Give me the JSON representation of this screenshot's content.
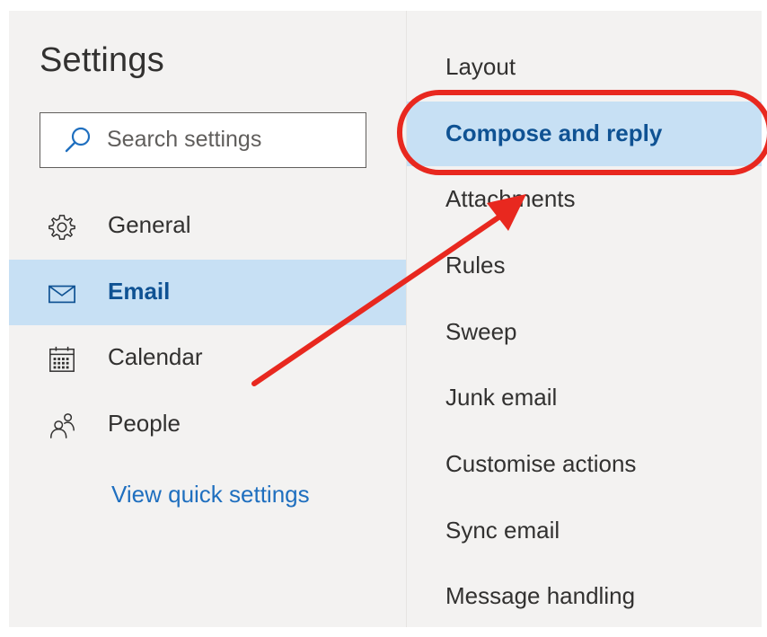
{
  "settings": {
    "title": "Settings",
    "search": {
      "placeholder": "Search settings",
      "icon": "search-icon"
    },
    "nav": [
      {
        "label": "General",
        "icon": "gear-icon",
        "selected": false
      },
      {
        "label": "Email",
        "icon": "mail-icon",
        "selected": true
      },
      {
        "label": "Calendar",
        "icon": "calendar-icon",
        "selected": false
      },
      {
        "label": "People",
        "icon": "people-icon",
        "selected": false
      }
    ],
    "quick_settings_link": "View quick settings"
  },
  "email_settings": {
    "items": [
      {
        "label": "Layout",
        "selected": false
      },
      {
        "label": "Compose and reply",
        "selected": true
      },
      {
        "label": "Attachments",
        "selected": false
      },
      {
        "label": "Rules",
        "selected": false
      },
      {
        "label": "Sweep",
        "selected": false
      },
      {
        "label": "Junk email",
        "selected": false
      },
      {
        "label": "Customise actions",
        "selected": false
      },
      {
        "label": "Sync email",
        "selected": false
      },
      {
        "label": "Message handling",
        "selected": false
      }
    ]
  },
  "colors": {
    "background": "#f3f2f1",
    "selected_background": "#c7e0f4",
    "selected_text": "#0f5293",
    "link": "#1f6fbf",
    "text": "#323130",
    "annotation_red": "#e8281f"
  }
}
